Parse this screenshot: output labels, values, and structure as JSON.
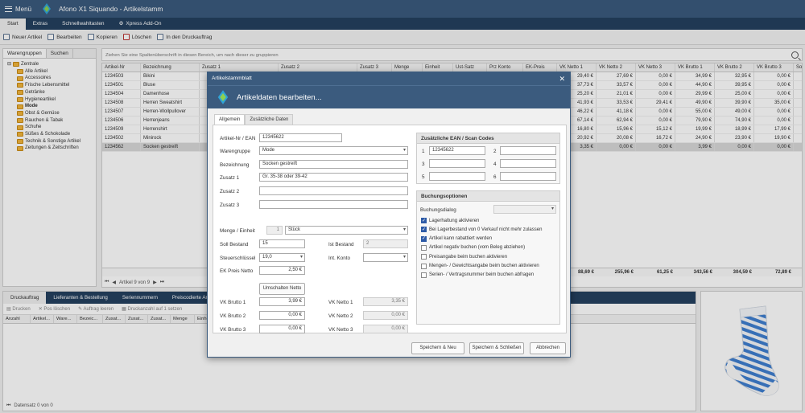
{
  "app": {
    "menu_label": "Menü",
    "title": "Afono X1 Siquando - Artikelstamm"
  },
  "ribbon_tabs": [
    "Start",
    "Extras",
    "Schnellwahltasten",
    "Xpress Add-On"
  ],
  "toolbar": [
    "Neuer Artikel",
    "Bearbeiten",
    "Kopieren",
    "Löschen",
    "In den Druckauftrag"
  ],
  "left_tabs": [
    "Warengruppen",
    "Suchen"
  ],
  "tree": {
    "root": "Zentrale",
    "items": [
      "Alle Artikel",
      "Accessoires",
      "Frische Lebensmittel",
      "Getränke",
      "Hygieneartikel",
      "Mode",
      "Obst & Gemüse",
      "Rauchen & Tabak",
      "Schuhe",
      "Süßes & Schokolade",
      "Technik & Sonstige Artikel",
      "Zeitungen & Zeitschriften"
    ],
    "bold_item": "Mode"
  },
  "group_hint": "Ziehen Sie eine Spaltenüberschrift in diesen Bereich, um nach dieser zu gruppieren",
  "grid": {
    "headers": [
      "Artikel-Nr",
      "Bezeichnung",
      "Zusatz 1",
      "Zusatz 2",
      "Zusatz 3",
      "Menge",
      "Einheit",
      "Ust-Satz",
      "Prz Konto",
      "EK-Preis",
      "VK Netto 1",
      "VK Netto 2",
      "VK Netto 3",
      "VK Brutto 1",
      "VK Brutto 2",
      "VK Brutto 3",
      "Soll"
    ],
    "rows": [
      [
        "1234503",
        "Bikini",
        "",
        "",
        "",
        "",
        "",
        "",
        "",
        "",
        "29,40 €",
        "27,69 €",
        "0,00 €",
        "34,99 €",
        "32,95 €",
        "0,00 €"
      ],
      [
        "1234501",
        "Bluse",
        "",
        "",
        "",
        "",
        "",
        "",
        "",
        "",
        "37,73 €",
        "33,57 €",
        "0,00 €",
        "44,90 €",
        "39,95 €",
        "0,00 €"
      ],
      [
        "1234504",
        "Damenhose",
        "",
        "",
        "",
        "",
        "",
        "",
        "",
        "",
        "25,20 €",
        "21,01 €",
        "0,00 €",
        "29,99 €",
        "25,00 €",
        "0,00 €"
      ],
      [
        "1234508",
        "Herren Sweatshirt",
        "",
        "",
        "",
        "",
        "",
        "",
        "",
        "",
        "41,93 €",
        "33,53 €",
        "29,41 €",
        "49,90 €",
        "39,90 €",
        "35,00 €"
      ],
      [
        "1234507",
        "Herren-Wollpullover",
        "",
        "",
        "",
        "",
        "",
        "",
        "",
        "",
        "46,22 €",
        "41,18 €",
        "0,00 €",
        "55,00 €",
        "49,00 €",
        "0,00 €"
      ],
      [
        "1234506",
        "Herrenjeans",
        "",
        "",
        "",
        "",
        "",
        "",
        "",
        "",
        "67,14 €",
        "62,94 €",
        "0,00 €",
        "79,90 €",
        "74,90 €",
        "0,00 €"
      ],
      [
        "1234509",
        "Herrenshirt",
        "",
        "",
        "",
        "",
        "",
        "",
        "",
        "",
        "16,80 €",
        "15,96 €",
        "15,12 €",
        "19,99 €",
        "18,99 €",
        "17,99 €"
      ],
      [
        "1234502",
        "Minirock",
        "",
        "",
        "",
        "",
        "",
        "",
        "",
        "",
        "20,92 €",
        "20,08 €",
        "16,72 €",
        "24,90 €",
        "23,90 €",
        "19,90 €"
      ],
      [
        "1234562",
        "Socken gestreift",
        "",
        "",
        "",
        "",
        "",
        "",
        "",
        "",
        "3,35 €",
        "0,00 €",
        "0,00 €",
        "3,99 €",
        "0,00 €",
        "0,00 €"
      ]
    ],
    "totals": [
      "88,69 €",
      "255,96 €",
      "61,25 €",
      "343,56 €",
      "304,59 €",
      "72,89 €"
    ],
    "nav": "Artikel 9 von 9"
  },
  "bottom": {
    "tabs": [
      "Druckauftrag",
      "Lieferanten & Bestellung",
      "Seriennummern",
      "Preiscodierte Ar"
    ],
    "tools": [
      "Drucken",
      "Pos löschen",
      "Auftrag leeren",
      "Druckanzahl auf 1 setzen"
    ],
    "headers": [
      "Anzahl",
      "Artikel...",
      "Ware...",
      "Bezeic...",
      "Zusat...",
      "Zusat...",
      "Zusat...",
      "Menge",
      "Einhe"
    ],
    "nav": "Datensatz 0 von 0"
  },
  "dialog": {
    "window_title": "Artikelstammblatt",
    "heading": "Artikeldaten bearbeiten...",
    "tabs": [
      "Allgemein",
      "Zusätzliche Daten"
    ],
    "labels": {
      "artnr": "Artikel-Nr / EAN",
      "warengruppe": "Warengruppe",
      "bezeichnung": "Bezeichnung",
      "zusatz1": "Zusatz 1",
      "zusatz2": "Zusatz 2",
      "zusatz3": "Zusatz 3",
      "menge": "Menge / Einheit",
      "soll": "Soll Bestand",
      "ist": "Ist Bestand",
      "steuer": "Steuerschlüssel",
      "konto": "Int. Konto",
      "ek": "EK Preis Netto",
      "umschalten": "Umschalten Netto",
      "vkb1": "VK Brutto 1",
      "vkb2": "VK Brutto 2",
      "vkb3": "VK Brutto 3",
      "vkn1": "VK Netto 1",
      "vkn2": "VK Netto 2",
      "vkn3": "VK Netto 3"
    },
    "values": {
      "artnr": "12345622",
      "warengruppe": "Mode",
      "bezeichnung": "Socken gestreift",
      "zusatz1": "Gr. 35-38 oder 39-42",
      "zusatz2": "",
      "zusatz3": "",
      "menge": "1",
      "einheit": "Stück",
      "soll": "15",
      "ist": "2",
      "steuer": "19,0",
      "konto": "",
      "ek": "2,50 €",
      "vkb1": "3,99 €",
      "vkb2": "0,00 €",
      "vkb3": "0,00 €",
      "vkn1": "3,35 €",
      "vkn2": "0,00 €",
      "vkn3": "0,00 €"
    },
    "ean_box": {
      "title": "Zusätzliche EAN / Scan Codes",
      "labels": [
        "1",
        "2",
        "3",
        "4",
        "5",
        "6"
      ],
      "values": [
        "12345622",
        "",
        "",
        "",
        "",
        ""
      ]
    },
    "booking_box": {
      "title": "Buchungsoptionen",
      "dialog_label": "Buchungsdialog",
      "options": [
        {
          "label": "Lagerhaltung aktivieren",
          "checked": true
        },
        {
          "label": "Bei Lagerbestand von 0 Verkauf nicht mehr zulassen",
          "checked": true
        },
        {
          "label": "Artikel kann rabattiert werden",
          "checked": true
        },
        {
          "label": "Artikel negativ buchen (vom Beleg abziehen)",
          "checked": false
        },
        {
          "label": "Preisangabe beim buchen aktivieren",
          "checked": false
        },
        {
          "label": "Mengen- / Gewichtsangabe beim buchen aktivieren",
          "checked": false
        },
        {
          "label": "Serien- / Vertragsnummer beim buchen abfragen",
          "checked": false
        }
      ]
    },
    "buttons": [
      "Speichern & Neu",
      "Speichern & Schließen",
      "Abbrechen"
    ]
  }
}
